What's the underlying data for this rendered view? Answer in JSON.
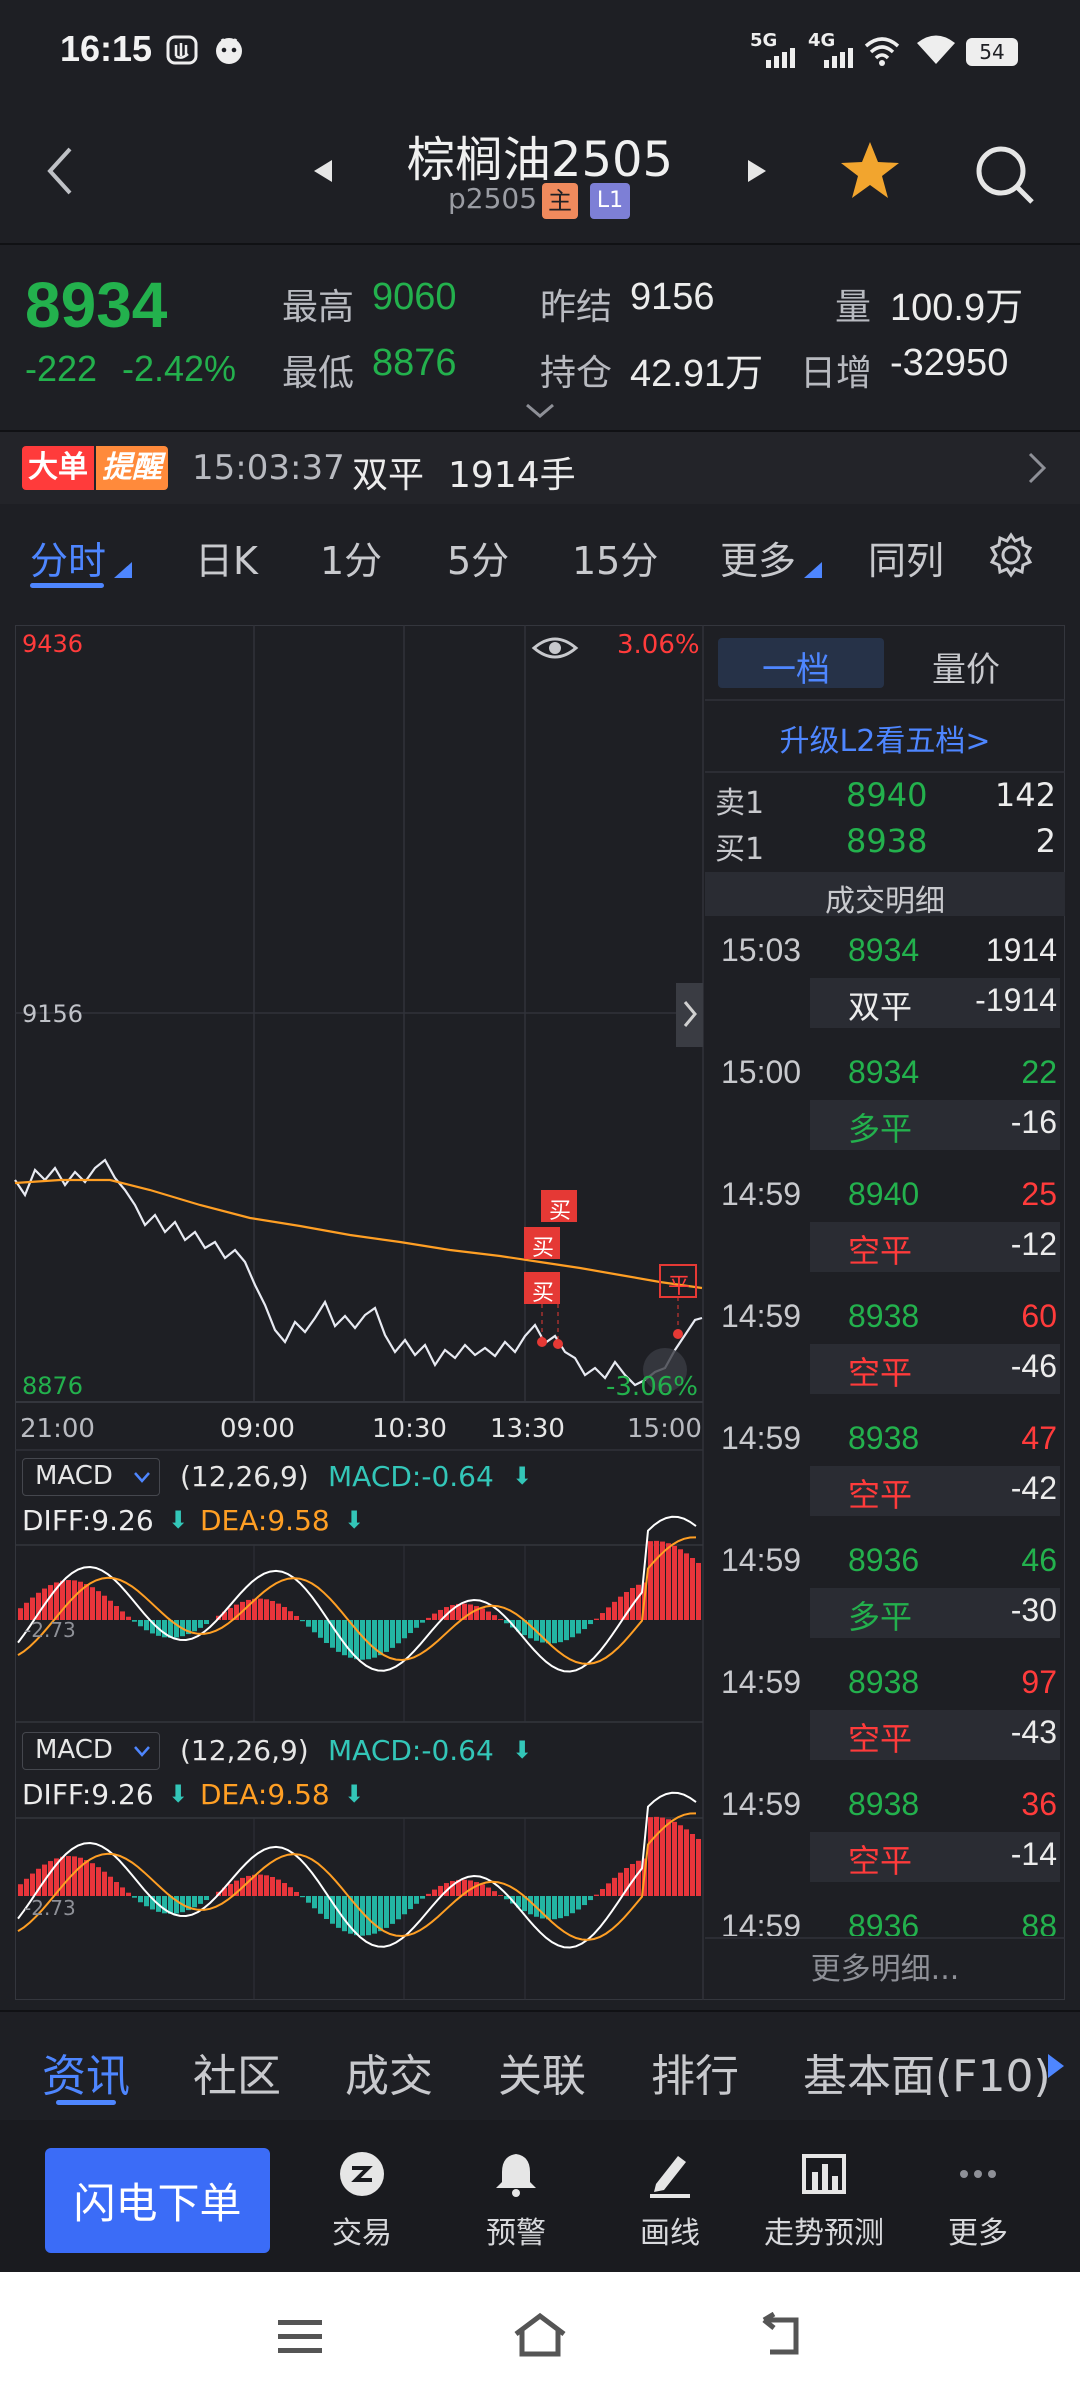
{
  "status_bar": {
    "time": "16:15",
    "battery": "54",
    "net1": "5G",
    "net2": "4G"
  },
  "header": {
    "title": "棕榈油2505",
    "code": "p2505",
    "badge_main": "主",
    "badge_level": "L1"
  },
  "quote": {
    "price": "8934",
    "change": "-222",
    "change_pct": "-2.42%",
    "high_label": "最高",
    "high": "9060",
    "low_label": "最低",
    "low": "8876",
    "prev_settle_label": "昨结",
    "prev_settle": "9156",
    "open_interest_label": "持仓",
    "open_interest": "42.91万",
    "volume_label": "量",
    "volume": "100.9万",
    "daily_change_label": "日增",
    "daily_change": "-32950"
  },
  "alert": {
    "tag_a": "大单",
    "tag_b": "提醒",
    "time": "15:03:37",
    "type": "双平",
    "size": "1914手"
  },
  "chart_tabs": [
    "分时",
    "日K",
    "1分",
    "5分",
    "15分",
    "更多",
    "同列"
  ],
  "intraday": {
    "top_price": "9436",
    "top_pct": "3.06%",
    "mid_price": "9156",
    "low_price": "8876",
    "low_pct": "-3.06%",
    "time_labels": [
      "21:00",
      "09:00",
      "10:30",
      "13:30",
      "15:00"
    ],
    "markers": [
      "买",
      "买",
      "买",
      "平"
    ]
  },
  "macd_panels": [
    {
      "name": "MACD",
      "params": "(12,26,9)",
      "macd": "MACD:-0.64",
      "diff": "DIFF:9.26",
      "dea": "DEA:9.58",
      "zero_label": "-2.73"
    },
    {
      "name": "MACD",
      "params": "(12,26,9)",
      "macd": "MACD:-0.64",
      "diff": "DIFF:9.26",
      "dea": "DEA:9.58",
      "zero_label": "-2.73"
    }
  ],
  "order_book": {
    "tabs": [
      "一档",
      "量价"
    ],
    "upgrade": "升级L2看五档>",
    "ask_label": "卖1",
    "ask_price": "8940",
    "ask_vol": "142",
    "bid_label": "买1",
    "bid_price": "8938",
    "bid_vol": "2",
    "detail_title": "成交明细",
    "trades": [
      {
        "time": "15:03",
        "price": "8934",
        "vol": "1914",
        "type": "双平",
        "oi": "-1914",
        "vcolor": "#ececec",
        "tcolor": "#ececec"
      },
      {
        "time": "15:00",
        "price": "8934",
        "vol": "22",
        "type": "多平",
        "oi": "-16",
        "vcolor": "#23b14d",
        "tcolor": "#23b14d"
      },
      {
        "time": "14:59",
        "price": "8940",
        "vol": "25",
        "type": "空平",
        "oi": "-12",
        "vcolor": "#ff3b3b",
        "tcolor": "#ff3b3b"
      },
      {
        "time": "14:59",
        "price": "8938",
        "vol": "60",
        "type": "空平",
        "oi": "-46",
        "vcolor": "#ff3b3b",
        "tcolor": "#ff3b3b"
      },
      {
        "time": "14:59",
        "price": "8938",
        "vol": "47",
        "type": "空平",
        "oi": "-42",
        "vcolor": "#ff3b3b",
        "tcolor": "#ff3b3b"
      },
      {
        "time": "14:59",
        "price": "8936",
        "vol": "46",
        "type": "多平",
        "oi": "-30",
        "vcolor": "#23b14d",
        "tcolor": "#23b14d"
      },
      {
        "time": "14:59",
        "price": "8938",
        "vol": "97",
        "type": "空平",
        "oi": "-43",
        "vcolor": "#ff3b3b",
        "tcolor": "#ff3b3b"
      },
      {
        "time": "14:59",
        "price": "8938",
        "vol": "36",
        "type": "空平",
        "oi": "-14",
        "vcolor": "#ff3b3b",
        "tcolor": "#ff3b3b"
      },
      {
        "time": "14:59",
        "price": "8936",
        "vol": "88",
        "type": "",
        "oi": "",
        "vcolor": "#23b14d",
        "tcolor": "#23b14d"
      }
    ],
    "more": "更多明细..."
  },
  "bottom_tabs": [
    "资讯",
    "社区",
    "成交",
    "关联",
    "排行",
    "基本面(F10)"
  ],
  "actions": {
    "flash_order": "闪电下单",
    "trade": "交易",
    "alert": "预警",
    "draw": "画线",
    "forecast": "走势预测",
    "more": "更多"
  },
  "colors": {
    "up": "#ff3b3b",
    "down": "#23b14d",
    "accent": "#3b6cf7",
    "avg_line": "#ff9f24"
  }
}
